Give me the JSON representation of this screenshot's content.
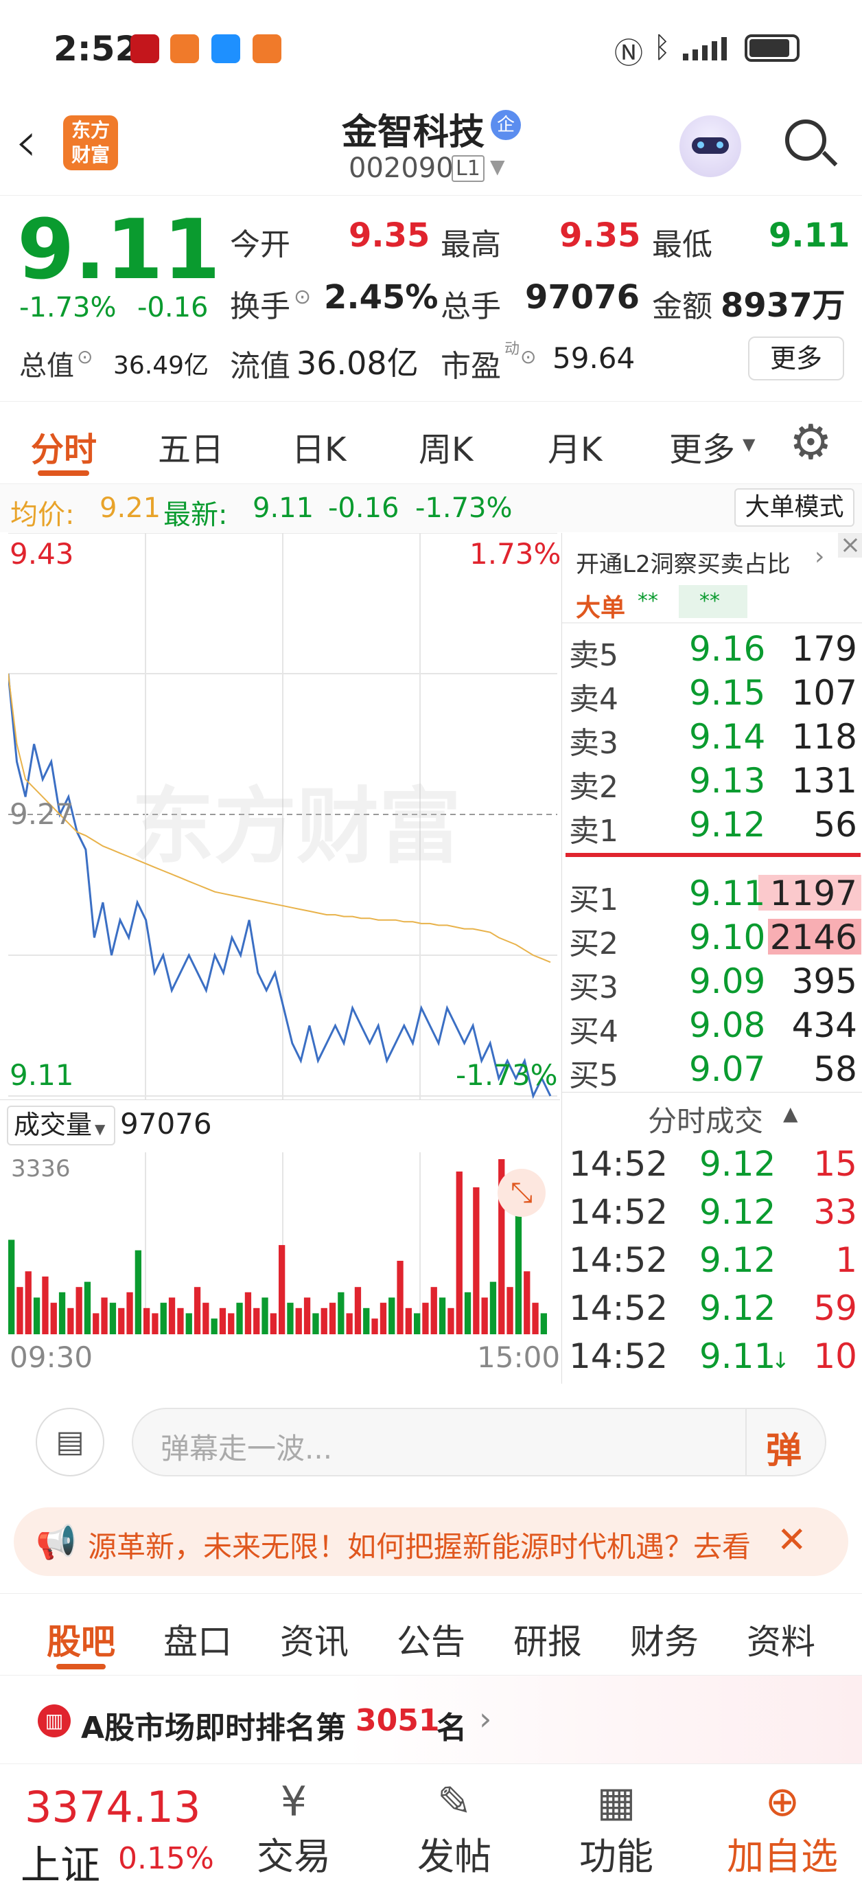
{
  "status": {
    "time": "2:52"
  },
  "nav": {
    "logo_line1": "东方",
    "logo_line2": "财富",
    "stock_name": "金智科技",
    "corp_badge": "企",
    "stock_code": "002090",
    "level": "L1"
  },
  "quote": {
    "price": "9.11",
    "change_pct": "-1.73%",
    "change": "-0.16",
    "open_label": "今开",
    "open": "9.35",
    "high_label": "最高",
    "high": "9.35",
    "low_label": "最低",
    "low": "9.11",
    "turnover_label": "换手",
    "turnover": "2.45%",
    "volume_label": "总手",
    "volume": "97076",
    "amount_label": "金额",
    "amount": "8937万",
    "mktcap_label": "总值",
    "mktcap": "36.49亿",
    "float_label": "流值",
    "float": "36.08亿",
    "pe_label": "市盈",
    "pe_sup": "动",
    "pe": "59.64",
    "more_button": "更多"
  },
  "tabs": [
    "分时",
    "五日",
    "日K",
    "周K",
    "月K",
    "更多"
  ],
  "avgbar": {
    "avg_label": "均价:",
    "avg": "9.21",
    "latest_label": "最新:",
    "latest": "9.11",
    "change": "-0.16",
    "pct": "-1.73%",
    "mode_button": "大单模式"
  },
  "chart": {
    "y_top": "9.43",
    "pct_top": "1.73%",
    "y_mid": "9.27",
    "y_bottom": "9.11",
    "pct_bottom": "-1.73%",
    "watermark": "东方财富",
    "volume_label": "成交量",
    "volume_total": "97076",
    "volume_max": "3336",
    "time_start": "09:30",
    "time_end": "15:00"
  },
  "chart_data": {
    "type": "line",
    "x_range": [
      "09:30",
      "15:00"
    ],
    "ylim": [
      9.11,
      9.43
    ],
    "series": [
      {
        "values": [
          9.35,
          9.3,
          9.28,
          9.31,
          9.29,
          9.3,
          9.27,
          9.28,
          9.26,
          9.25,
          9.2,
          9.22,
          9.19,
          9.21,
          9.2,
          9.22,
          9.21,
          9.18,
          9.19,
          9.17,
          9.18,
          9.19,
          9.18,
          9.17,
          9.19,
          9.18,
          9.2,
          9.19,
          9.21,
          9.18,
          9.17,
          9.18,
          9.16,
          9.14,
          9.13,
          9.15,
          9.13,
          9.14,
          9.15,
          9.14,
          9.16,
          9.15,
          9.14,
          9.15,
          9.13,
          9.14,
          9.15,
          9.14,
          9.16,
          9.15,
          9.14,
          9.16,
          9.15,
          9.14,
          9.15,
          9.13,
          9.14,
          9.12,
          9.13,
          9.12,
          9.13,
          9.11,
          9.12,
          9.11
        ],
        "color": "#3b6fc4"
      },
      {
        "values": [
          9.35,
          9.31,
          9.29,
          9.285,
          9.28,
          9.275,
          9.27,
          9.265,
          9.26,
          9.258,
          9.255,
          9.252,
          9.25,
          9.248,
          9.246,
          9.244,
          9.242,
          9.24,
          9.238,
          9.236,
          9.234,
          9.232,
          9.23,
          9.228,
          9.226,
          9.225,
          9.224,
          9.223,
          9.222,
          9.221,
          9.22,
          9.219,
          9.218,
          9.217,
          9.216,
          9.215,
          9.214,
          9.213,
          9.213,
          9.212,
          9.212,
          9.211,
          9.211,
          9.21,
          9.21,
          9.21,
          9.209,
          9.209,
          9.208,
          9.208,
          9.207,
          9.207,
          9.206,
          9.205,
          9.205,
          9.204,
          9.203,
          9.2,
          9.198,
          9.196,
          9.193,
          9.19,
          9.188,
          9.186
        ],
        "color": "#e8b24a"
      }
    ],
    "volume": {
      "max": 3336,
      "values": [
        1800,
        900,
        1200,
        700,
        1100,
        600,
        800,
        500,
        900,
        1000,
        400,
        700,
        600,
        500,
        800,
        1600,
        500,
        400,
        600,
        700,
        500,
        400,
        900,
        600,
        300,
        500,
        400,
        600,
        800,
        500,
        700,
        400,
        1700,
        600,
        500,
        700,
        400,
        500,
        600,
        800,
        400,
        900,
        500,
        300,
        600,
        700,
        1400,
        500,
        400,
        600,
        900,
        700,
        500,
        3100,
        800,
        2800,
        700,
        1000,
        3336,
        900,
        2500,
        1200,
        600,
        400
      ]
    }
  },
  "orderbook": {
    "l2_text": "开通L2洞察买卖占比",
    "big_label": "大单",
    "big_val1": "**",
    "big_val2": "**",
    "sell": [
      {
        "label": "卖5",
        "price": "9.16",
        "vol": "179"
      },
      {
        "label": "卖4",
        "price": "9.15",
        "vol": "107"
      },
      {
        "label": "卖3",
        "price": "9.14",
        "vol": "118"
      },
      {
        "label": "卖2",
        "price": "9.13",
        "vol": "131"
      },
      {
        "label": "卖1",
        "price": "9.12",
        "vol": "56"
      }
    ],
    "buy": [
      {
        "label": "买1",
        "price": "9.11",
        "vol": "1197"
      },
      {
        "label": "买2",
        "price": "9.10",
        "vol": "2146"
      },
      {
        "label": "买3",
        "price": "9.09",
        "vol": "395"
      },
      {
        "label": "买4",
        "price": "9.08",
        "vol": "434"
      },
      {
        "label": "买5",
        "price": "9.07",
        "vol": "58"
      }
    ],
    "trades_title": "分时成交",
    "trades": [
      {
        "time": "14:52",
        "price": "9.12",
        "vol": "15"
      },
      {
        "time": "14:52",
        "price": "9.12",
        "vol": "33"
      },
      {
        "time": "14:52",
        "price": "9.12",
        "vol": "1"
      },
      {
        "time": "14:52",
        "price": "9.12",
        "vol": "59"
      },
      {
        "time": "14:52",
        "price": "9.11",
        "arrow": "↓",
        "vol": "10"
      }
    ]
  },
  "danmu": {
    "placeholder": "弹幕走一波...",
    "send": "弹"
  },
  "banner": {
    "text": "源革新，未来无限！如何把握新能源时代机遇？去看"
  },
  "bottom_tabs": [
    "股吧",
    "盘口",
    "资讯",
    "公告",
    "研报",
    "财务",
    "资料"
  ],
  "rank": {
    "prefix": "A股市场即时排名第",
    "number": "3051",
    "suffix": "名"
  },
  "footer": {
    "index_value": "3374.13",
    "index_name": "上证",
    "index_pct": "0.15%",
    "trade": "交易",
    "post": "发帖",
    "func": "功能",
    "add": "加自选"
  }
}
